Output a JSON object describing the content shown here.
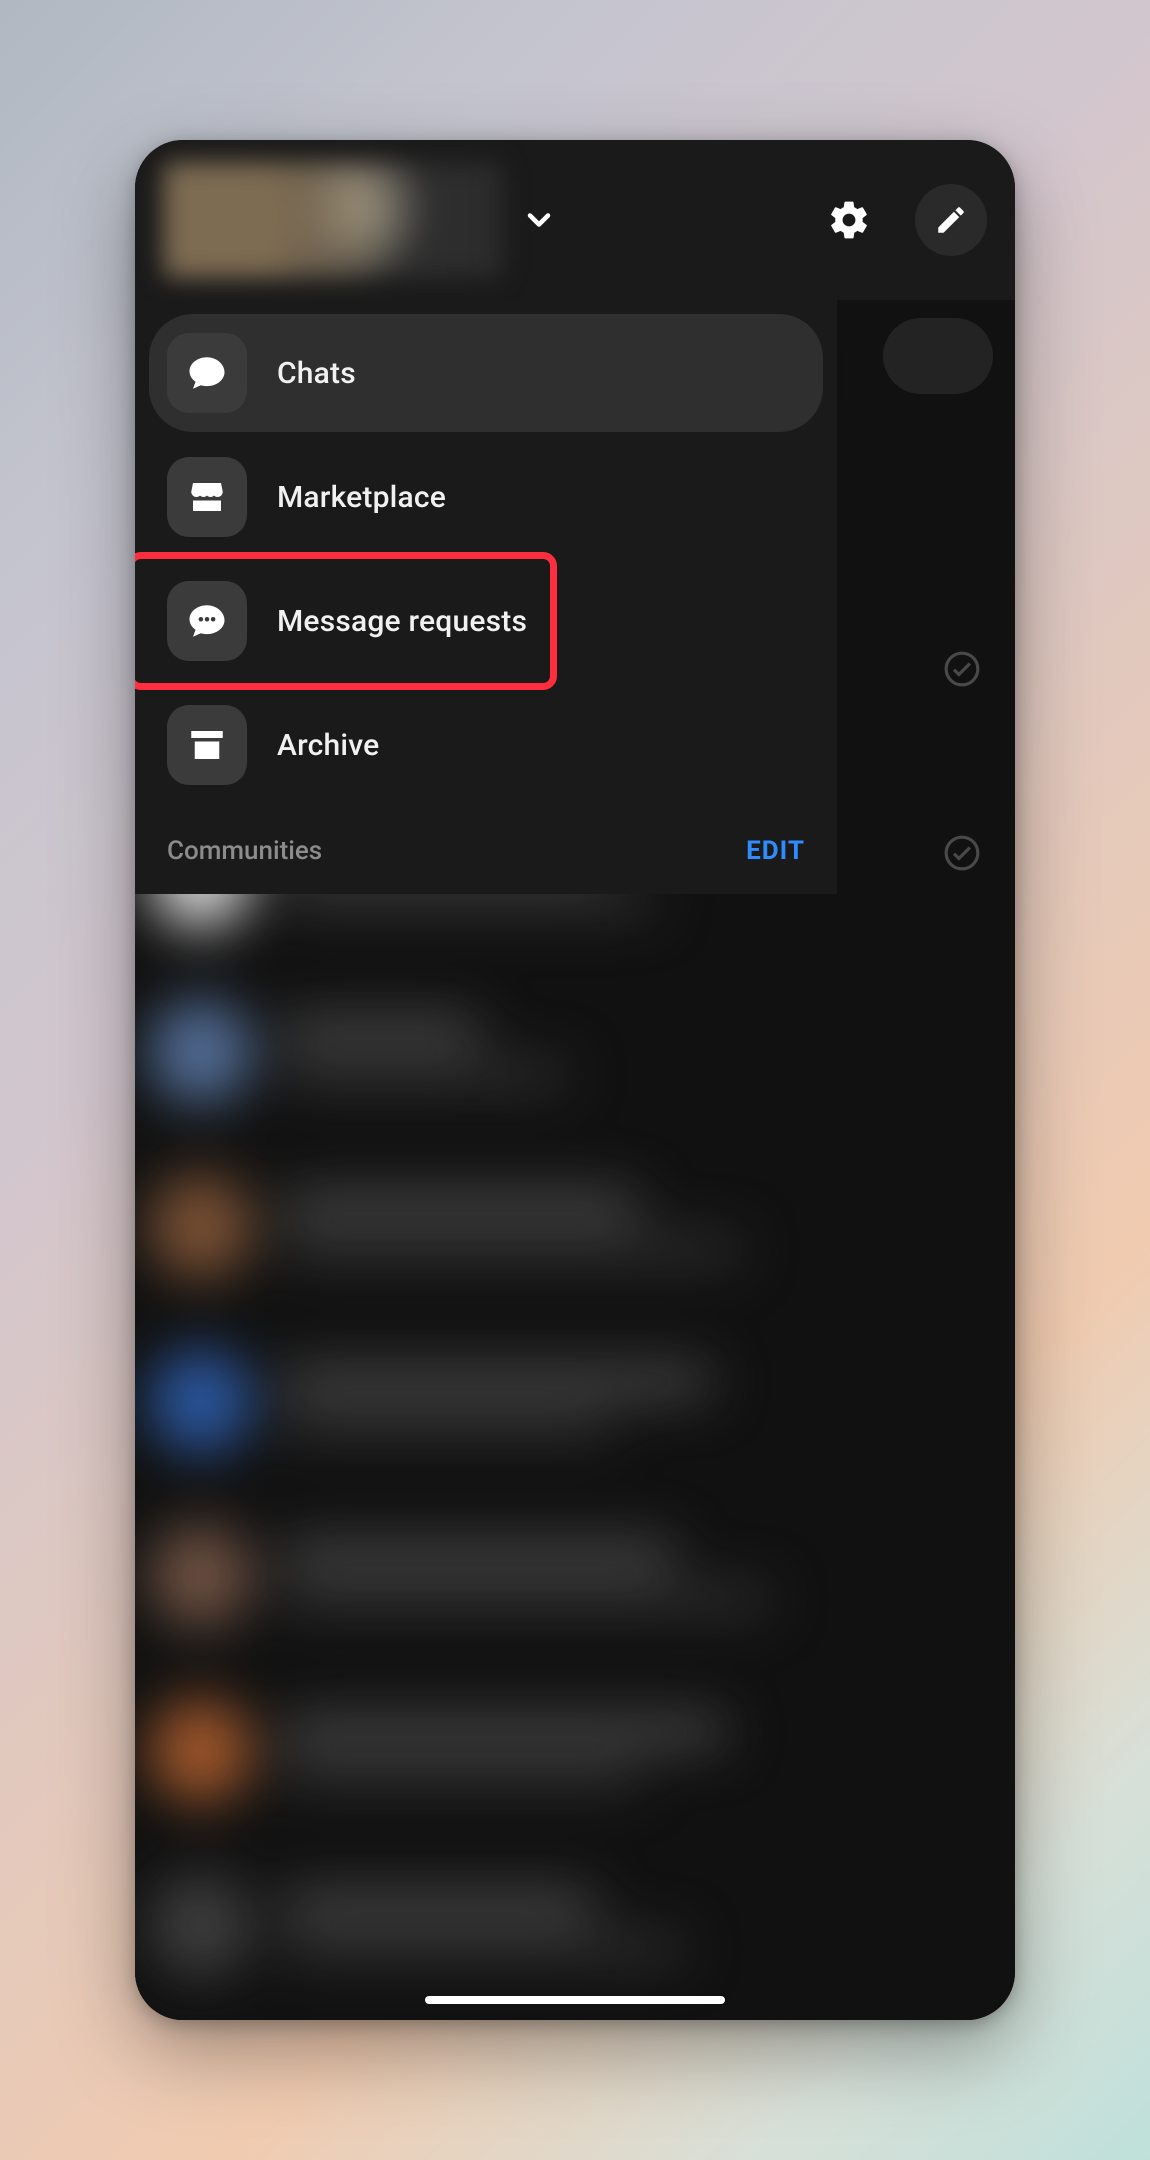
{
  "colors": {
    "panel_bg": "#1a1a1a",
    "active_bg": "#2f2f2f",
    "icon_tile": "#3b3b3b",
    "text": "#f1f1f1",
    "muted": "#8c8c8c",
    "accent_link": "#2f8cff",
    "highlight": "#ff2e3f"
  },
  "header": {
    "profile_name_placeholder": "",
    "dropdown_icon": "chevron-down-icon",
    "settings_icon": "gear-icon",
    "compose_icon": "pencil-icon"
  },
  "menu": {
    "items": [
      {
        "id": "chats",
        "label": "Chats",
        "icon": "chat-bubble-icon",
        "active": true
      },
      {
        "id": "marketplace",
        "label": "Marketplace",
        "icon": "storefront-icon",
        "active": false
      },
      {
        "id": "message-requests",
        "label": "Message requests",
        "icon": "chat-ellipsis-icon",
        "active": false,
        "highlighted": true
      },
      {
        "id": "archive",
        "label": "Archive",
        "icon": "archive-box-icon",
        "active": false
      }
    ]
  },
  "communities": {
    "heading": "Communities",
    "edit_label": "EDIT"
  },
  "background_right_indicators": [
    {
      "kind": "pill"
    },
    {
      "kind": "check"
    },
    {
      "kind": "check"
    }
  ],
  "home_indicator": true
}
